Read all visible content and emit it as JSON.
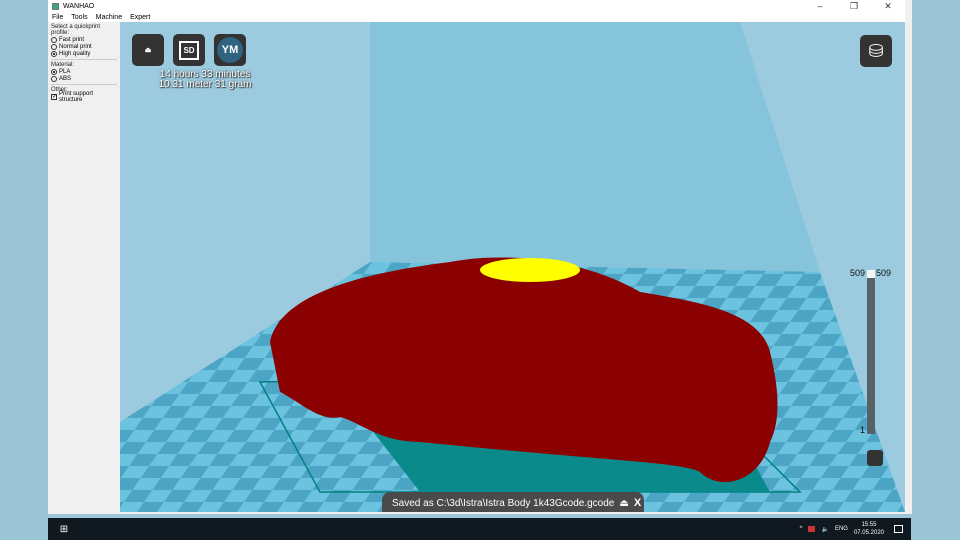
{
  "window": {
    "title": "WANHAO",
    "controls": [
      "–",
      "❐",
      "✕"
    ]
  },
  "menu": [
    "File",
    "Tools",
    "Machine",
    "Expert"
  ],
  "panel": {
    "profile_label": "Select a quickprint profile:",
    "profiles": [
      {
        "label": "Fast print",
        "selected": false
      },
      {
        "label": "Normal print",
        "selected": false
      },
      {
        "label": "High quality",
        "selected": true
      }
    ],
    "material_label": "Material:",
    "materials": [
      {
        "label": "PLA",
        "selected": true
      },
      {
        "label": "ABS",
        "selected": false
      }
    ],
    "other_label": "Other:",
    "support_label": "Print support structure",
    "support_checked": true
  },
  "toolbar": {
    "sd_label": "SD",
    "ym_label": "YM"
  },
  "stats": {
    "time": "14 hours 33 minutes",
    "material": "10.31 meter 31 gram"
  },
  "layer_slider": {
    "top_left": "509",
    "top_right": "509",
    "bottom": "1",
    "value_fraction": 1.0
  },
  "toast": {
    "message": "Saved as C:\\3d\\Istra\\Istra Body 1k43Gcode.gcode",
    "close": "X"
  },
  "taskbar": {
    "lang": "ENG",
    "time": "15:55",
    "date": "07.05.2020",
    "tray_chevron": "^",
    "volume": "🔈"
  },
  "colors": {
    "model": "#8b0000",
    "top": "#ffff00",
    "floor_light": "#6cc3e0",
    "floor_dark": "#4ca5c4",
    "outline": "#008080"
  }
}
